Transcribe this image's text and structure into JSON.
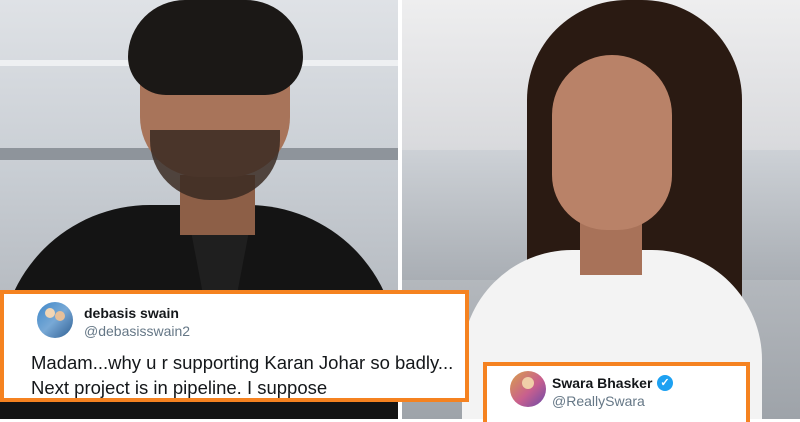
{
  "left_tweet": {
    "name": "debasis swain",
    "handle": "@debasisswain2",
    "text_line1": "Madam...why u r supporting Karan Johar  so badly...",
    "text_line2": "Next project is in pipeline. I suppose"
  },
  "right_tweet": {
    "name": "Swara Bhasker",
    "handle": "@ReallySwara",
    "verified_icon": "✓"
  },
  "colors": {
    "frame": "#f58220",
    "verified": "#1da1f2",
    "handle": "#657786",
    "text": "#14171a"
  }
}
